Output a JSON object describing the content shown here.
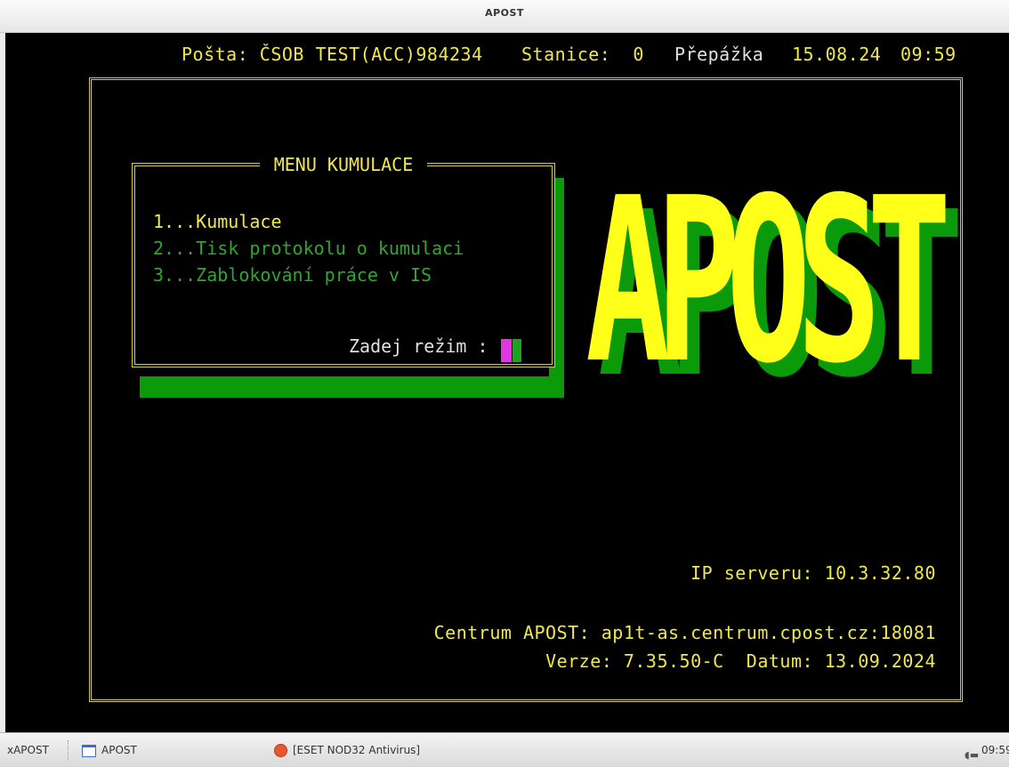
{
  "window": {
    "title": "APOST"
  },
  "status_line": {
    "posta": "Pošta: ČSOB TEST(ACC)984234",
    "stanice": "Stanice:  0",
    "prepazka": "Přepážka",
    "date": "15.08.24",
    "time": "09:59"
  },
  "menu": {
    "title": "MENU KUMULACE",
    "items": [
      {
        "label": "1...Kumulace",
        "color": "#f2e84a",
        "selected": true
      },
      {
        "label": "2...Tisk protokolu o kumulaci",
        "color": "#2fa62f",
        "selected": false
      },
      {
        "label": "3...Zablokování práce v IS",
        "color": "#2fa62f",
        "selected": false
      }
    ],
    "prompt": "Zadej režim :",
    "input_value": ""
  },
  "logo": {
    "text": "APOST",
    "color": "#ffff1a",
    "shadow_color": "#0a9a0a"
  },
  "info": {
    "ip_serveru": "IP serveru: 10.3.32.80",
    "centrum": "Centrum APOST: ap1t-as.centrum.cpost.cz:18081",
    "verze": "Verze: 7.35.50-C  Datum: 13.09.2024"
  },
  "taskbar": {
    "start_label": "xAPOST",
    "items": [
      {
        "label": "APOST",
        "icon": "window-icon"
      },
      {
        "label": "[ESET NOD32 Antivirus]",
        "icon": "eset-icon"
      }
    ],
    "clock": "09:59",
    "tray_icon": "network-volume-icon"
  }
}
